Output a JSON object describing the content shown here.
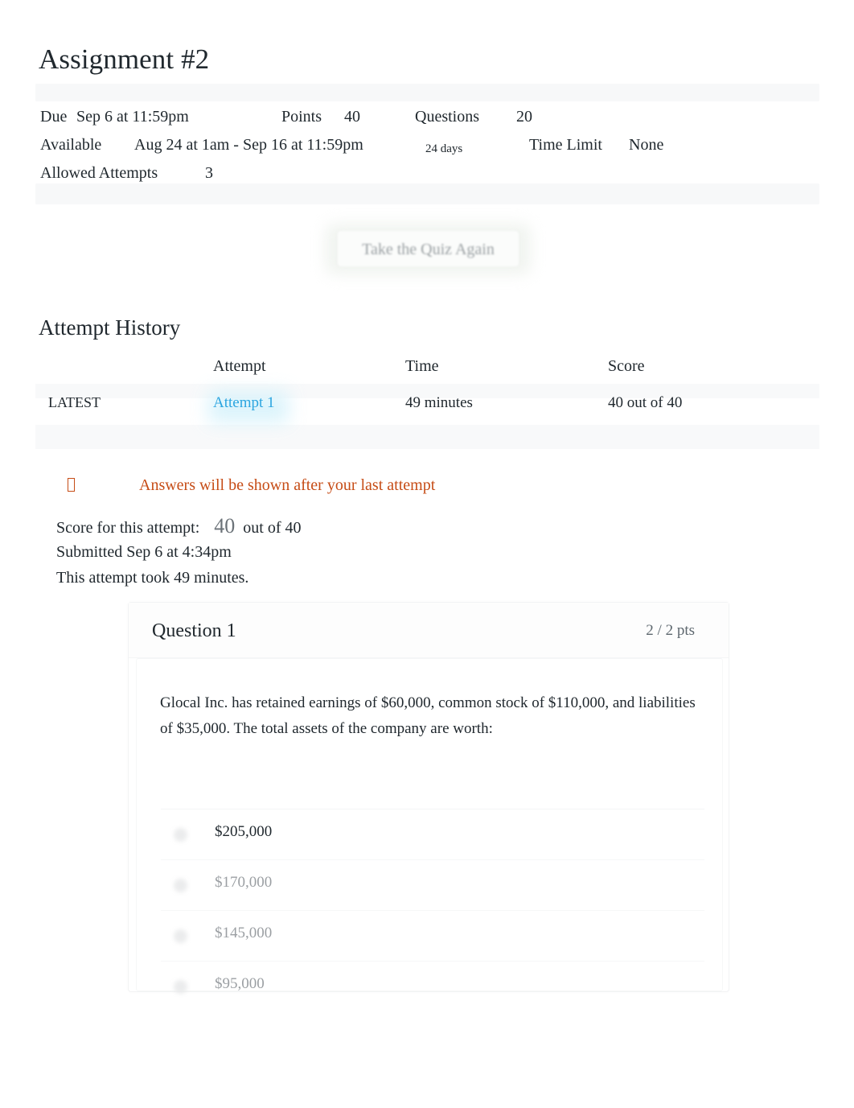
{
  "quiz": {
    "title": "Assignment #2",
    "meta": {
      "due_label": "Due",
      "due_value": "Sep 6 at 11:59pm",
      "points_label": "Points",
      "points_value": "40",
      "questions_label": "Questions",
      "questions_value": "20",
      "available_label": "Available",
      "available_value": "Aug 24 at 1am - Sep 16 at 11:59pm",
      "available_duration": "24 days",
      "time_limit_label": "Time Limit",
      "time_limit_value": "None",
      "attempts_label": "Allowed Attempts",
      "attempts_value": "3"
    },
    "take_again_button": "Take the Quiz Again"
  },
  "attempt_history": {
    "heading": "Attempt History",
    "columns": [
      "",
      "Attempt",
      "Time",
      "Score"
    ],
    "rows": [
      {
        "latest": "LATEST",
        "attempt": "Attempt 1",
        "time": "49 minutes",
        "score": "40 out of 40"
      }
    ]
  },
  "notice": {
    "icon": "warning-icon",
    "text": "Answers will be shown after your last attempt"
  },
  "attempt_summary": {
    "score_label": "Score for this attempt:",
    "score_value": "40",
    "score_suffix": "out of 40",
    "submitted": "Submitted Sep 6 at 4:34pm",
    "duration": "This attempt took 49 minutes."
  },
  "question": {
    "name": "Question 1",
    "points": "2 / 2 pts",
    "text": "Glocal Inc. has retained earnings of $60,000, common stock of $110,000, and liabilities of $35,000. The total assets of the company are worth:",
    "answers": [
      {
        "label": "$205,000",
        "selected": true
      },
      {
        "label": "$170,000",
        "selected": false
      },
      {
        "label": "$145,000",
        "selected": false
      },
      {
        "label": "$95,000",
        "selected": false
      }
    ]
  },
  "colors": {
    "link": "#2ca5e0",
    "warning": "#c64c16",
    "text": "#20282e",
    "muted": "#9b9fa3"
  }
}
